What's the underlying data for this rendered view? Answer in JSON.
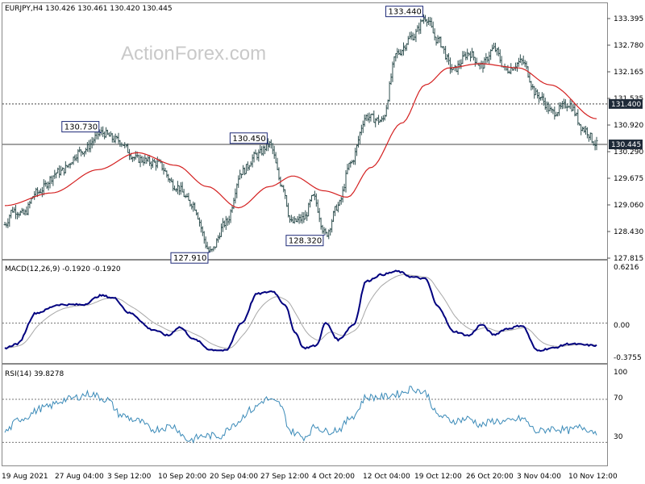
{
  "chart_data": {
    "type": "candlestick",
    "symbol_line": "EURJPY,H4  130.426 130.461 130.420 130.445",
    "watermark": "ActionForex.com",
    "colors": {
      "price": "#2f4f4f",
      "ma": "#d42020",
      "macd": "#00007f",
      "signal": "#a8a8a8",
      "rsi": "#3a8ab8",
      "grid": "#777777",
      "badge": "#1e2a38",
      "tag": "#1e2a78"
    },
    "x_ticks": [
      "19 Aug 2021",
      "27 Aug 04:00",
      "3 Sep 12:00",
      "10 Sep 20:00",
      "20 Sep 04:00",
      "27 Sep 12:00",
      "4 Oct 20:00",
      "12 Oct 04:00",
      "19 Oct 12:00",
      "26 Oct 20:00",
      "3 Nov 04:00",
      "10 Nov 12:00"
    ],
    "price_panel": {
      "y_ticks": [
        "133.395",
        "132.780",
        "132.165",
        "131.535",
        "130.920",
        "130.290",
        "129.675",
        "129.060",
        "128.430",
        "127.815"
      ],
      "ylim": [
        127.8,
        133.7
      ],
      "anchors": [
        [
          0,
          128.55
        ],
        [
          5,
          128.9
        ],
        [
          12,
          128.8
        ],
        [
          20,
          129.3
        ],
        [
          35,
          129.8
        ],
        [
          50,
          130.3
        ],
        [
          62,
          130.72
        ],
        [
          72,
          130.55
        ],
        [
          85,
          130.1
        ],
        [
          98,
          130.0
        ],
        [
          110,
          129.45
        ],
        [
          120,
          129.05
        ],
        [
          132,
          127.91
        ],
        [
          142,
          128.6
        ],
        [
          152,
          129.8
        ],
        [
          162,
          130.2
        ],
        [
          170,
          130.45
        ],
        [
          178,
          129.5
        ],
        [
          184,
          128.6
        ],
        [
          192,
          128.7
        ],
        [
          198,
          129.2
        ],
        [
          206,
          128.32
        ],
        [
          214,
          129.0
        ],
        [
          222,
          130.0
        ],
        [
          232,
          131.1
        ],
        [
          242,
          131.0
        ],
        [
          252,
          132.6
        ],
        [
          262,
          133.0
        ],
        [
          270,
          133.44
        ],
        [
          278,
          132.9
        ],
        [
          288,
          132.2
        ],
        [
          298,
          132.6
        ],
        [
          306,
          132.3
        ],
        [
          314,
          132.7
        ],
        [
          322,
          132.2
        ],
        [
          332,
          132.4
        ],
        [
          342,
          131.6
        ],
        [
          352,
          131.2
        ],
        [
          362,
          131.4
        ],
        [
          372,
          130.8
        ],
        [
          380,
          130.445
        ]
      ],
      "ma_anchors": [
        [
          0,
          129.0
        ],
        [
          30,
          129.3
        ],
        [
          60,
          129.85
        ],
        [
          85,
          130.25
        ],
        [
          110,
          129.95
        ],
        [
          130,
          129.45
        ],
        [
          150,
          128.95
        ],
        [
          170,
          129.45
        ],
        [
          185,
          129.7
        ],
        [
          205,
          129.35
        ],
        [
          220,
          129.2
        ],
        [
          235,
          129.9
        ],
        [
          255,
          130.95
        ],
        [
          270,
          131.85
        ],
        [
          285,
          132.25
        ],
        [
          305,
          132.35
        ],
        [
          330,
          132.25
        ],
        [
          350,
          131.85
        ],
        [
          380,
          131.05
        ]
      ],
      "hlines": [
        {
          "value": 131.4,
          "label": "131.400",
          "dotted": true
        },
        {
          "value": 130.445,
          "label": "130.445",
          "dotted": false
        }
      ],
      "annotations": [
        {
          "text": "130.730",
          "x": 62,
          "y": 130.72,
          "place": "left-above"
        },
        {
          "text": "127.910",
          "x": 132,
          "y": 127.91,
          "place": "left-below"
        },
        {
          "text": "130.450",
          "x": 170,
          "y": 130.45,
          "place": "left-above"
        },
        {
          "text": "128.320",
          "x": 206,
          "y": 128.32,
          "place": "left-below"
        },
        {
          "text": "133.440",
          "x": 270,
          "y": 133.44,
          "place": "left-above"
        }
      ]
    },
    "macd_panel": {
      "title": "MACD(12,26,9) -0.1920 -0.1920",
      "y_ticks": [
        "0.6216",
        "0.00",
        "-0.3755"
      ],
      "ylim": [
        -0.46,
        0.72
      ],
      "anchors": [
        [
          0,
          -0.3
        ],
        [
          8,
          -0.25
        ],
        [
          20,
          0.12
        ],
        [
          35,
          0.22
        ],
        [
          50,
          0.22
        ],
        [
          62,
          0.33
        ],
        [
          70,
          0.3
        ],
        [
          80,
          0.12
        ],
        [
          95,
          -0.08
        ],
        [
          105,
          -0.15
        ],
        [
          112,
          -0.05
        ],
        [
          122,
          -0.2
        ],
        [
          132,
          -0.32
        ],
        [
          142,
          -0.33
        ],
        [
          152,
          0.0
        ],
        [
          162,
          0.35
        ],
        [
          172,
          0.38
        ],
        [
          180,
          0.22
        ],
        [
          186,
          -0.1
        ],
        [
          192,
          -0.3
        ],
        [
          200,
          -0.27
        ],
        [
          206,
          0.0
        ],
        [
          214,
          -0.2
        ],
        [
          224,
          -0.02
        ],
        [
          232,
          0.5
        ],
        [
          242,
          0.58
        ],
        [
          252,
          0.62
        ],
        [
          262,
          0.55
        ],
        [
          270,
          0.53
        ],
        [
          278,
          0.2
        ],
        [
          288,
          -0.1
        ],
        [
          298,
          -0.15
        ],
        [
          306,
          -0.02
        ],
        [
          314,
          -0.14
        ],
        [
          322,
          -0.07
        ],
        [
          332,
          -0.03
        ],
        [
          342,
          -0.33
        ],
        [
          352,
          -0.3
        ],
        [
          362,
          -0.25
        ],
        [
          380,
          -0.27
        ]
      ]
    },
    "rsi_panel": {
      "title": "RSI(14) 39.8278",
      "y_ticks": [
        "100",
        "70",
        "30"
      ],
      "ylim": [
        10,
        100
      ],
      "levels": [
        70,
        30
      ],
      "anchors": [
        [
          0,
          40
        ],
        [
          10,
          52
        ],
        [
          25,
          62
        ],
        [
          40,
          70
        ],
        [
          55,
          75
        ],
        [
          65,
          70
        ],
        [
          75,
          55
        ],
        [
          85,
          50
        ],
        [
          95,
          42
        ],
        [
          108,
          45
        ],
        [
          118,
          32
        ],
        [
          128,
          36
        ],
        [
          138,
          36
        ],
        [
          148,
          48
        ],
        [
          158,
          60
        ],
        [
          168,
          70
        ],
        [
          176,
          66
        ],
        [
          184,
          40
        ],
        [
          192,
          35
        ],
        [
          200,
          45
        ],
        [
          206,
          40
        ],
        [
          214,
          42
        ],
        [
          224,
          55
        ],
        [
          232,
          72
        ],
        [
          242,
          72
        ],
        [
          252,
          75
        ],
        [
          262,
          80
        ],
        [
          270,
          76
        ],
        [
          278,
          55
        ],
        [
          288,
          50
        ],
        [
          298,
          52
        ],
        [
          306,
          46
        ],
        [
          314,
          50
        ],
        [
          322,
          49
        ],
        [
          332,
          52
        ],
        [
          342,
          40
        ],
        [
          352,
          43
        ],
        [
          362,
          41
        ],
        [
          370,
          44
        ],
        [
          380,
          39.8278
        ]
      ]
    }
  }
}
